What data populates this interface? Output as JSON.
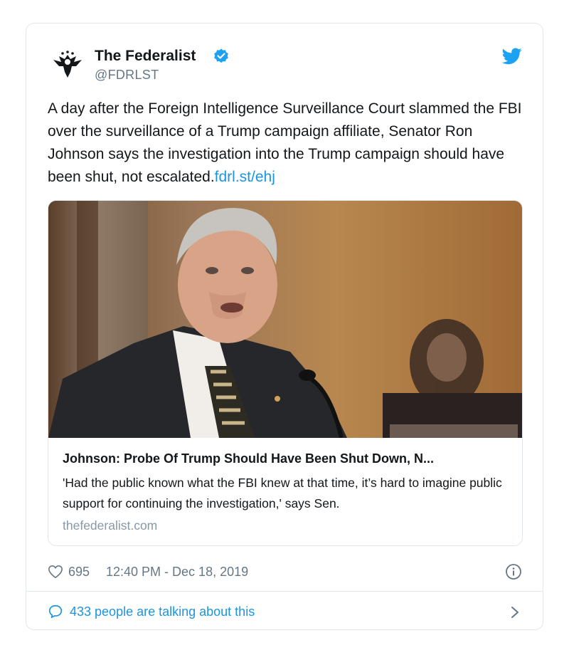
{
  "tweet": {
    "author_name": "The Federalist",
    "handle": "@FDRLST",
    "text": "A day after the Foreign Intelligence Surveillance Court slammed the FBI over the surveillance of a Trump campaign affiliate, Senator Ron Johnson says the investigation into the Trump campaign should have been shut, not escalated.",
    "link_text": "fdrl.st/ehj",
    "verified": true,
    "icons": {
      "avatar": "eagle-logo",
      "verified": "verified-badge-icon",
      "brand": "twitter-bird-icon"
    }
  },
  "link_card": {
    "title": "Johnson: Probe Of Trump Should Have Been Shut Down, N...",
    "description": "'Had the public known what the FBI knew at that time, it’s hard to imagine public support for continuing the investigation,' says Sen.",
    "domain": "thefederalist.com",
    "image": "photo-of-senator-speaking"
  },
  "meta": {
    "likes": "695",
    "timestamp": "12:40 PM - Dec 18, 2019",
    "icons": {
      "like": "heart-icon",
      "info": "info-icon"
    }
  },
  "conversation": {
    "label": "433 people are talking about this",
    "icons": {
      "reply": "speech-bubble-icon",
      "more": "chevron-right-icon"
    }
  },
  "colors": {
    "accent": "#1b95e0",
    "muted": "#657786",
    "border": "#e1e8ed",
    "text": "#14171a"
  }
}
